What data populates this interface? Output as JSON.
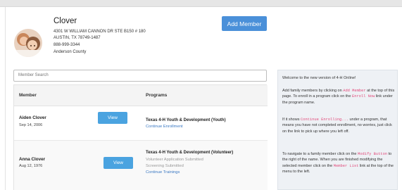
{
  "family": {
    "name": "Clover",
    "address_line1": "4301 W WILLIAM CANNON DR STE B150 # 180",
    "address_line2": "AUSTIN, TX 78749-1487",
    "phone": "888-999-3344",
    "county": "Anderson County"
  },
  "header": {
    "add_member_label": "Add Member"
  },
  "search": {
    "placeholder": "Member Search"
  },
  "table": {
    "col_member": "Member",
    "col_programs": "Programs",
    "rows": [
      {
        "name": "Aiden Clover",
        "dob": "Sep 14, 2006",
        "view_label": "View",
        "program": "Texas 4-H Youth & Development (Youth)",
        "status_lines": [],
        "action_link": "Continue Enrollment"
      },
      {
        "name": "Anna Clover",
        "dob": "Aug 12, 1976",
        "view_label": "View",
        "program": "Texas 4-H Youth & Development (Volunteer)",
        "status_lines": [
          "Volunteer Application Submitted",
          "Screening Submitted"
        ],
        "action_link": "Continue Trainings"
      }
    ]
  },
  "info": {
    "welcome": "Welcome to the new version of 4-H Online!",
    "p1_a": "Add family members by clicking on ",
    "p1_code1": "Add Member",
    "p1_b": " at the top of this page. To enroll in a program click on the ",
    "p1_code2": "Enroll Now",
    "p1_c": " link under the program name.",
    "p2_a": "If it shows ",
    "p2_code": "Continue Enrolling...",
    "p2_b": " under a program, that means you have not completed enrollment, no worries, just click on the link to pick up where you left off.",
    "p3_a": "To navigate to a family member click on the ",
    "p3_code1": "Modify Button",
    "p3_b": " to the right of the name. When you are finished modifying the selected member click on the ",
    "p3_code2": "Member List",
    "p3_c": " link at the top of the menu to the left."
  },
  "colors": {
    "primary_button": "#4a90d9",
    "link": "#3a78c2",
    "code_text": "#e14a7a",
    "info_bg": "#eef1f5"
  }
}
